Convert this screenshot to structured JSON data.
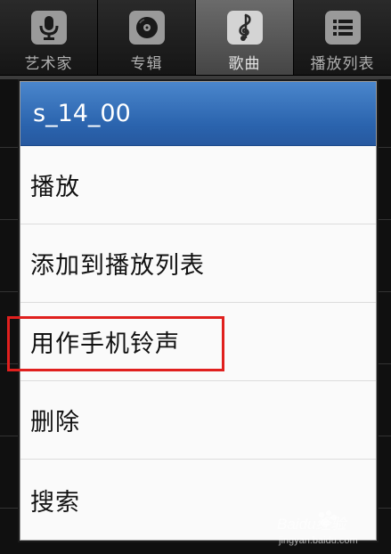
{
  "tabs": [
    {
      "label": "艺术家",
      "icon": "microphone-icon",
      "selected": false
    },
    {
      "label": "专辑",
      "icon": "disc-icon",
      "selected": false
    },
    {
      "label": "歌曲",
      "icon": "music-note-icon",
      "selected": true
    },
    {
      "label": "播放列表",
      "icon": "playlist-icon",
      "selected": false
    }
  ],
  "dialog": {
    "title": "s_14_00",
    "items": [
      {
        "label": "播放"
      },
      {
        "label": "添加到播放列表"
      },
      {
        "label": "用作手机铃声",
        "highlighted": true
      },
      {
        "label": "删除"
      },
      {
        "label": "搜索"
      }
    ]
  },
  "watermark": {
    "text": "Baidu经验",
    "url": "jingyan.baidu.com"
  },
  "colors": {
    "dialog_header": "#2a63ad",
    "highlight": "#e0201e",
    "tab_selected": "#5a5a5a"
  }
}
